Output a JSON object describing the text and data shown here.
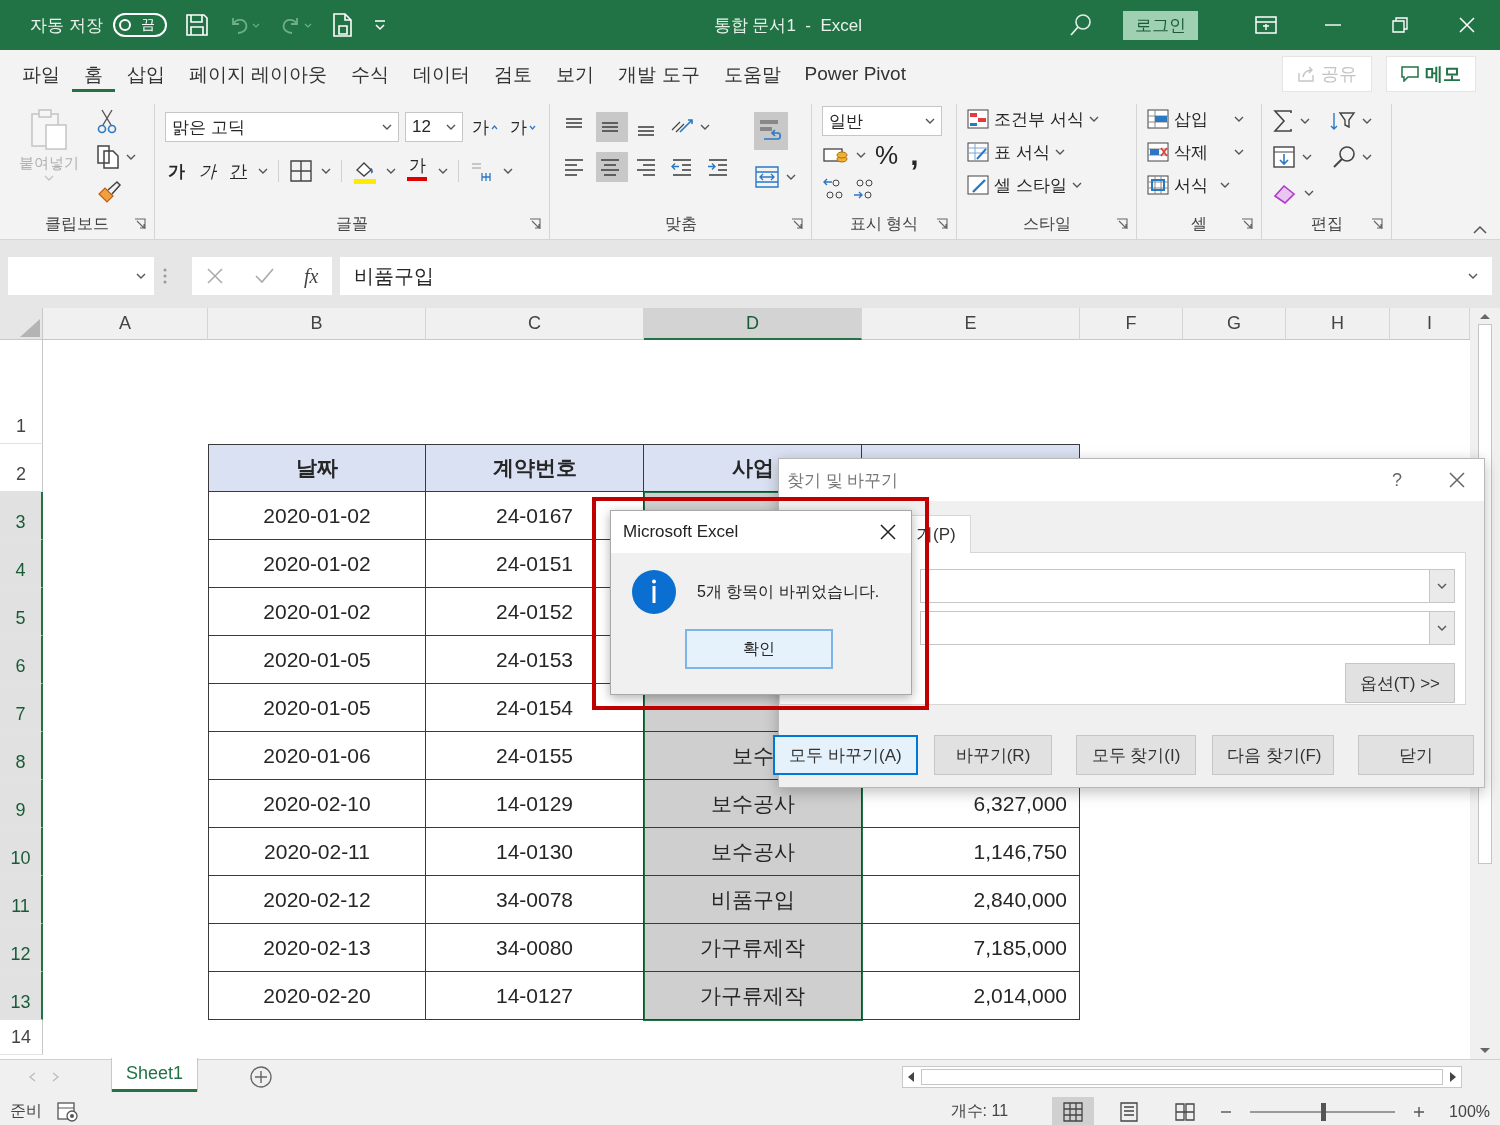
{
  "title_bar": {
    "autosave_label": "자동 저장",
    "autosave": {
      "label": "끔",
      "on": false
    },
    "document_title": "통합 문서1  -  Excel",
    "login": "로그인"
  },
  "menu_tabs": [
    {
      "label": "파일",
      "selected": false
    },
    {
      "label": "홈",
      "selected": true
    },
    {
      "label": "삽입",
      "selected": false
    },
    {
      "label": "페이지 레이아웃",
      "selected": false
    },
    {
      "label": "수식",
      "selected": false
    },
    {
      "label": "데이터",
      "selected": false
    },
    {
      "label": "검토",
      "selected": false
    },
    {
      "label": "보기",
      "selected": false
    },
    {
      "label": "개발 도구",
      "selected": false
    },
    {
      "label": "도움말",
      "selected": false
    },
    {
      "label": "Power Pivot",
      "selected": false
    }
  ],
  "share": {
    "label": "공유",
    "disabled": true
  },
  "memo": "메모",
  "ribbon": {
    "clipboard": {
      "group": "클립보드",
      "paste": {
        "label": "붙여넣기",
        "disabled": true
      }
    },
    "font": {
      "group": "글꼴",
      "name": "맑은 고딕",
      "size": "12",
      "grow": "가",
      "shrink": "가",
      "bold": "가",
      "italic": "가",
      "underline": "간",
      "font_color_button": "가"
    },
    "alignment": {
      "group": "맞춤",
      "vertical": [
        {
          "kind": "top",
          "selected": false
        },
        {
          "kind": "middle",
          "selected": true
        },
        {
          "kind": "bottom",
          "selected": false
        }
      ],
      "horizontal": [
        {
          "kind": "left",
          "selected": false
        },
        {
          "kind": "center",
          "selected": true
        },
        {
          "kind": "right",
          "selected": false
        },
        {
          "kind": "outdent",
          "selected": false
        },
        {
          "kind": "indent",
          "selected": false
        }
      ],
      "wrap": {
        "selected": true
      }
    },
    "number": {
      "group": "표시 형식",
      "format": "일반",
      "percent": "%",
      "comma": ","
    },
    "styles": {
      "group": "스타일",
      "items": [
        "조건부 서식",
        "표 서식",
        "셀 스타일"
      ]
    },
    "cells": {
      "group": "셀",
      "items": [
        "삽입",
        "삭제",
        "서식"
      ]
    },
    "editing": {
      "group": "편집"
    }
  },
  "formula_bar": {
    "fx": "fx",
    "value": "비품구입"
  },
  "sheet": {
    "columns": [
      {
        "label": "A",
        "selected": false
      },
      {
        "label": "B",
        "selected": false
      },
      {
        "label": "C",
        "selected": false
      },
      {
        "label": "D",
        "selected": true
      },
      {
        "label": "E",
        "selected": false
      },
      {
        "label": "F",
        "selected": false
      },
      {
        "label": "G",
        "selected": false
      },
      {
        "label": "H",
        "selected": false
      },
      {
        "label": "I",
        "selected": false
      }
    ],
    "rows": [
      {
        "label": "1",
        "selected": false
      },
      {
        "label": "2",
        "selected": false
      },
      {
        "label": "3",
        "selected": true
      },
      {
        "label": "4",
        "selected": true
      },
      {
        "label": "5",
        "selected": true
      },
      {
        "label": "6",
        "selected": true
      },
      {
        "label": "7",
        "selected": true
      },
      {
        "label": "8",
        "selected": true
      },
      {
        "label": "9",
        "selected": true
      },
      {
        "label": "10",
        "selected": true
      },
      {
        "label": "11",
        "selected": true
      },
      {
        "label": "12",
        "selected": true
      },
      {
        "label": "13",
        "selected": true
      },
      {
        "label": "14",
        "selected": false
      }
    ],
    "table": {
      "header": {
        "date": "날짜",
        "contract": "계약번호",
        "business": "사업"
      },
      "rows": [
        {
          "date": "2020-01-02",
          "contract": "24-0167"
        },
        {
          "date": "2020-01-02",
          "contract": "24-0151"
        },
        {
          "date": "2020-01-02",
          "contract": "24-0152"
        },
        {
          "date": "2020-01-05",
          "contract": "24-0153"
        },
        {
          "date": "2020-01-05",
          "contract": "24-0154"
        },
        {
          "date": "2020-01-06",
          "contract": "24-0155",
          "business": "보수"
        },
        {
          "date": "2020-02-10",
          "contract": "14-0129",
          "business": "보수공사",
          "amount": "6,327,000"
        },
        {
          "date": "2020-02-11",
          "contract": "14-0130",
          "business": "보수공사",
          "amount": "1,146,750"
        },
        {
          "date": "2020-02-12",
          "contract": "34-0078",
          "business": "비품구입",
          "amount": "2,840,000"
        },
        {
          "date": "2020-02-13",
          "contract": "34-0080",
          "business": "가구류제작",
          "amount": "7,185,000"
        },
        {
          "date": "2020-02-20",
          "contract": "14-0127",
          "business": "가구류제작",
          "amount": "2,014,000"
        }
      ]
    }
  },
  "sheet_tabs": [
    {
      "label": "Sheet1",
      "selected": true
    }
  ],
  "status_bar": {
    "ready": "준비",
    "count": "개수: 11",
    "views": [
      {
        "kind": "normal",
        "selected": true
      },
      {
        "kind": "page_layout",
        "selected": false
      },
      {
        "kind": "page_break",
        "selected": false
      }
    ],
    "zoom": {
      "level": 0.5,
      "reading": "100%"
    }
  },
  "find_dialog": {
    "title": "찾기 및 바꾸기",
    "help": "?",
    "tab": "기(P)",
    "options_button": "옵션(T) >>",
    "buttons": [
      {
        "label": "모두 바꾸기(A)",
        "selected": true
      },
      {
        "label": "바꾸기(R)",
        "selected": false
      },
      {
        "label": "모두 찾기(I)",
        "selected": false
      },
      {
        "label": "다음 찾기(F)",
        "selected": false
      },
      {
        "label": "닫기",
        "selected": false
      }
    ]
  },
  "message_box": {
    "title": "Microsoft Excel",
    "message": "5개 항목이 바뀌었습니다.",
    "ok": "확인"
  }
}
